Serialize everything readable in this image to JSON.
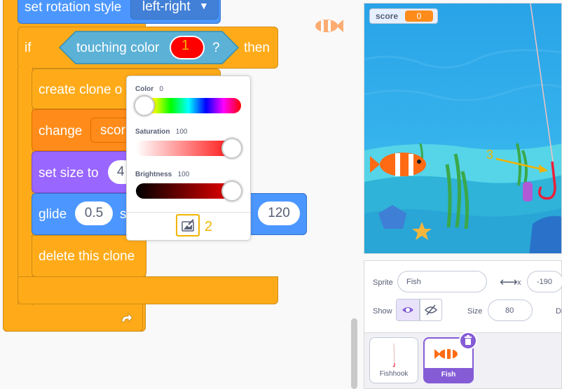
{
  "code": {
    "rotation_label": "set rotation style",
    "rotation_value": "left-right",
    "if_label": "if",
    "touching_color_label": "touching color",
    "touching_color_swatch": "#ff0000",
    "question_mark": "?",
    "then_label": "then",
    "create_clone_label": "create clone o",
    "change_label": "change",
    "change_var_value": "scor",
    "set_size_label": "set size to",
    "set_size_value": "4",
    "glide_label": "glide",
    "glide_secs": "0.5",
    "glide_s": "s",
    "glide_value": "120",
    "delete_clone_label": "delete this clone",
    "annotation_1": "1"
  },
  "picker": {
    "color_label": "Color",
    "color_value": "0",
    "saturation_label": "Saturation",
    "saturation_value": "100",
    "brightness_label": "Brightness",
    "brightness_value": "100",
    "annotation_2": "2"
  },
  "stage": {
    "score_label": "score",
    "score_value": "0",
    "annotation_3": "3"
  },
  "sprite_info": {
    "sprite_label": "Sprite",
    "sprite_name": "Fish",
    "x_label": "x",
    "x_value": "-190",
    "show_label": "Show",
    "size_label": "Size",
    "size_value": "80",
    "direction_label_partial": "Di"
  },
  "sprites": [
    {
      "name": "Fishhook",
      "selected": false
    },
    {
      "name": "Fish",
      "selected": true
    }
  ],
  "colors": {
    "control": "#ffab19",
    "data": "#ff8c1a",
    "looks": "#9966ff",
    "motion": "#4c97ff",
    "sensing": "#5cb1d6",
    "annotation": "#f0b400",
    "selected_sprite": "#855cd6"
  }
}
